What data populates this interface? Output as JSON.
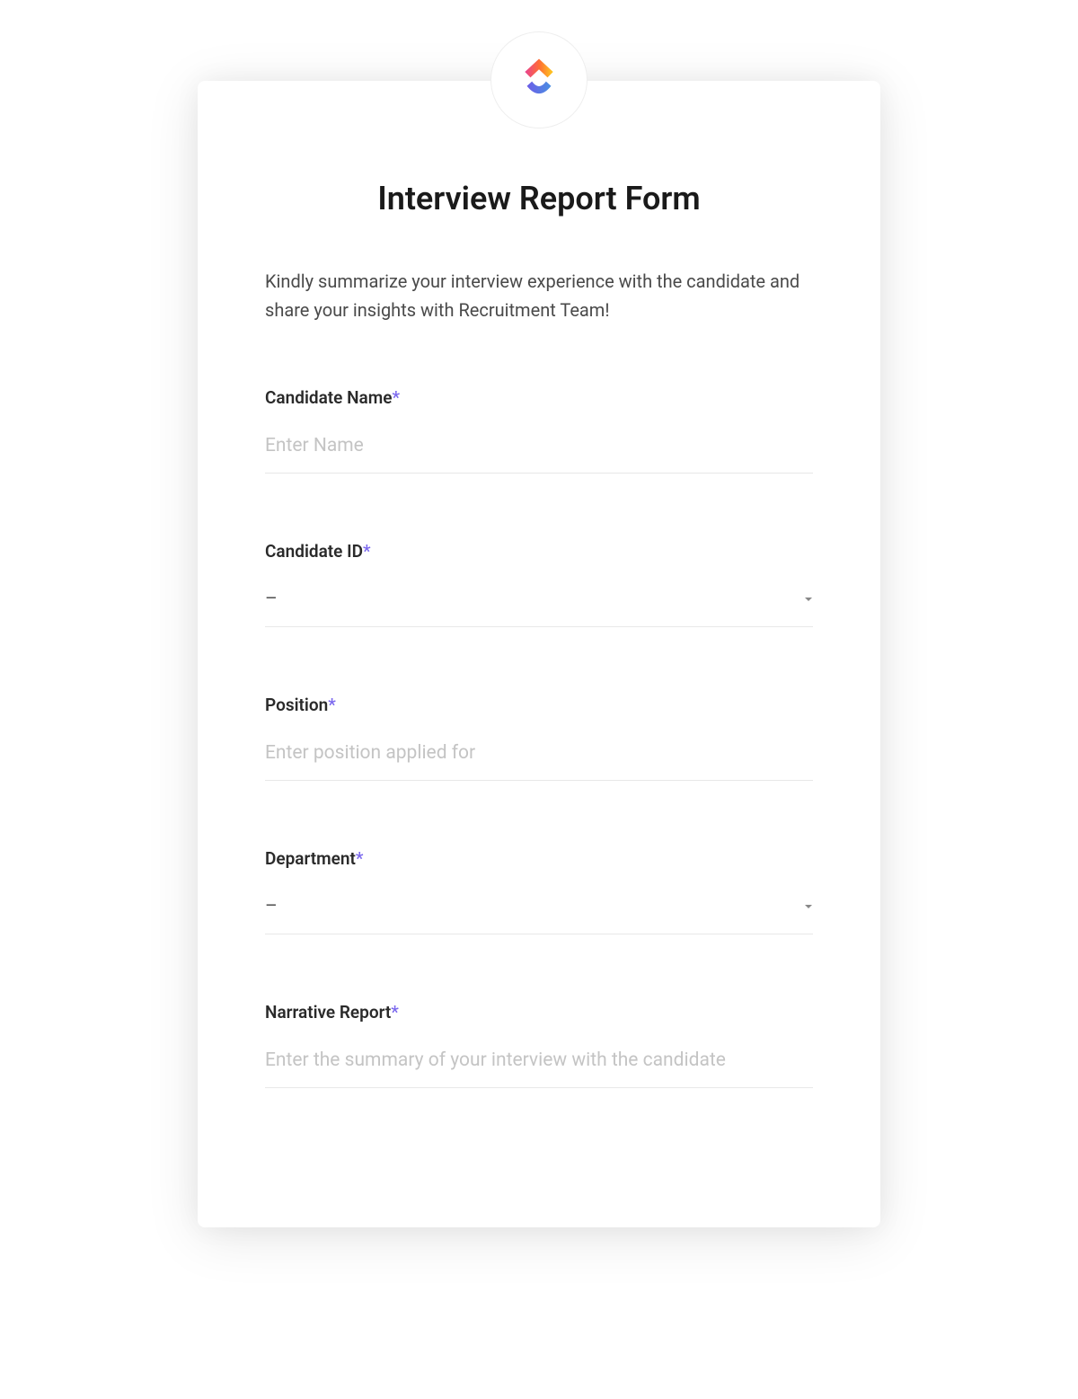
{
  "form": {
    "title": "Interview Report Form",
    "description": "Kindly summarize your interview experience with the candidate and share your insights with Recruitment Team!",
    "fields": {
      "candidateName": {
        "label": "Candidate Name",
        "required": "*",
        "placeholder": "Enter Name",
        "value": ""
      },
      "candidateId": {
        "label": "Candidate ID",
        "required": "*",
        "selected": "–"
      },
      "position": {
        "label": "Position",
        "required": "*",
        "placeholder": "Enter position applied for",
        "value": ""
      },
      "department": {
        "label": "Department",
        "required": "*",
        "selected": "–"
      },
      "narrativeReport": {
        "label": "Narrative Report",
        "required": "*",
        "placeholder": "Enter the summary of your interview with the candidate",
        "value": ""
      }
    }
  }
}
